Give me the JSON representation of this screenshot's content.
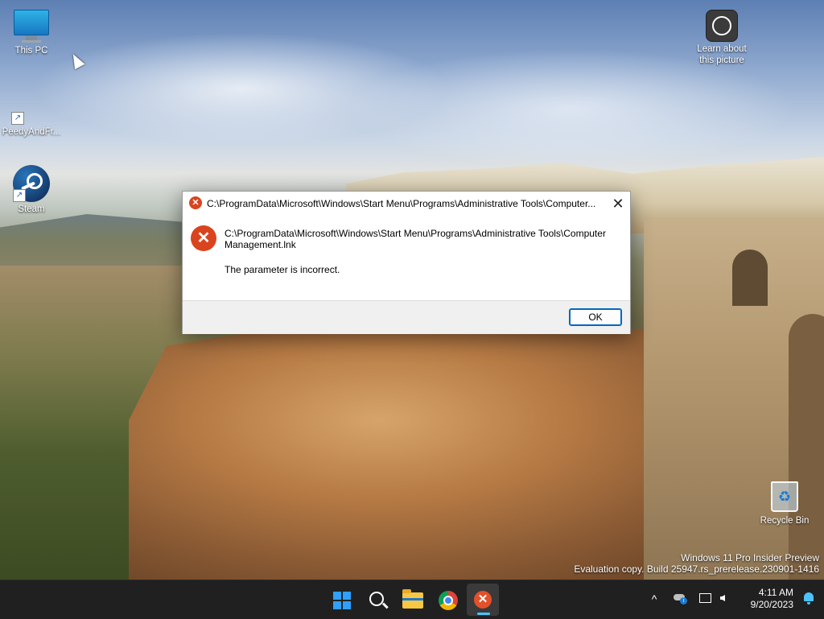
{
  "desktop": {
    "icons": [
      {
        "label": "This PC",
        "icon": "pc-monitor-icon"
      },
      {
        "label": "PeedyAndFr...",
        "icon": "peedy-shortcut-icon"
      },
      {
        "label": "Steam",
        "icon": "steam-icon"
      },
      {
        "label": "Learn about this picture",
        "icon": "learn-about-picture-icon"
      },
      {
        "label": "Recycle Bin",
        "icon": "recycle-bin-icon"
      }
    ],
    "watermark": {
      "line1": "Windows 11 Pro Insider Preview",
      "line2": "Evaluation copy. Build 25947.rs_prerelease.230901-1416"
    }
  },
  "dialog": {
    "title": "C:\\ProgramData\\Microsoft\\Windows\\Start Menu\\Programs\\Administrative Tools\\Computer...",
    "close_glyph": "✕",
    "path_line1": "C:\\ProgramData\\Microsoft\\Windows\\Start Menu\\Programs\\Administrative Tools\\Computer",
    "path_line2": "Management.lnk",
    "message": "The parameter is incorrect.",
    "ok_label": "OK",
    "error_glyph": "✕",
    "accent_color": "#d9441f"
  },
  "taskbar": {
    "apps": [
      {
        "name": "Start",
        "icon": "windows-start-icon"
      },
      {
        "name": "Search",
        "icon": "search-icon"
      },
      {
        "name": "File Explorer",
        "icon": "folder-icon"
      },
      {
        "name": "Google Chrome",
        "icon": "chrome-icon"
      },
      {
        "name": "Error dialog",
        "icon": "error-icon",
        "active": true
      }
    ],
    "tray": {
      "chevron": "^",
      "time": "4:11 AM",
      "date": "9/20/2023"
    }
  }
}
